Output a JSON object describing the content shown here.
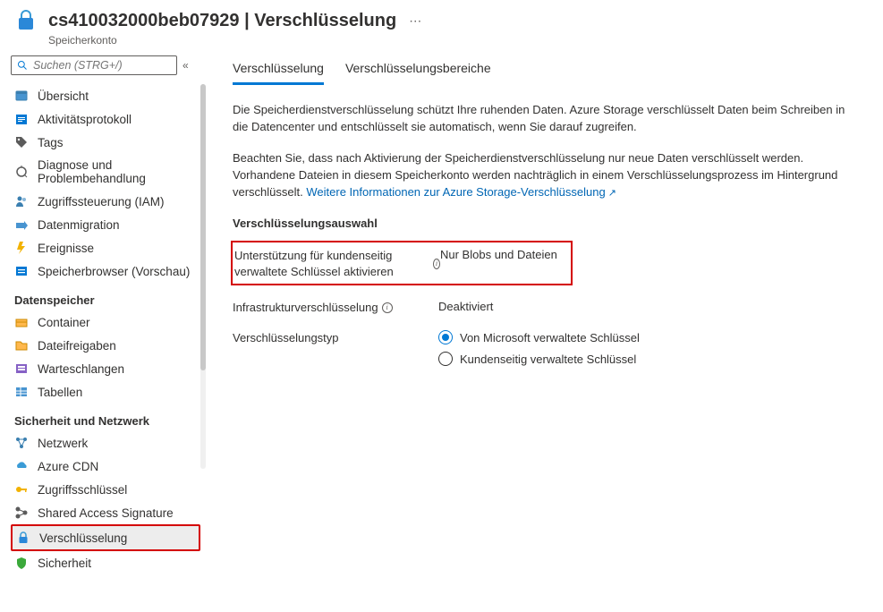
{
  "header": {
    "title": "cs410032000beb07929 | Verschlüsselung",
    "subtitle": "Speicherkonto"
  },
  "search": {
    "placeholder": "Suchen (STRG+/)"
  },
  "nav": {
    "general": [
      {
        "label": "Übersicht",
        "icon": "overview"
      },
      {
        "label": "Aktivitätsprotokoll",
        "icon": "activity"
      },
      {
        "label": "Tags",
        "icon": "tags"
      },
      {
        "label": "Diagnose und Problembehandlung",
        "icon": "diagnose"
      },
      {
        "label": "Zugriffssteuerung (IAM)",
        "icon": "iam"
      },
      {
        "label": "Datenmigration",
        "icon": "migration"
      },
      {
        "label": "Ereignisse",
        "icon": "events"
      },
      {
        "label": "Speicherbrowser (Vorschau)",
        "icon": "browser"
      }
    ],
    "datastore_title": "Datenspeicher",
    "datastore": [
      {
        "label": "Container",
        "icon": "container"
      },
      {
        "label": "Dateifreigaben",
        "icon": "fileshare"
      },
      {
        "label": "Warteschlangen",
        "icon": "queue"
      },
      {
        "label": "Tabellen",
        "icon": "table"
      }
    ],
    "security_title": "Sicherheit und Netzwerk",
    "security": [
      {
        "label": "Netzwerk",
        "icon": "network"
      },
      {
        "label": "Azure CDN",
        "icon": "cdn"
      },
      {
        "label": "Zugriffsschlüssel",
        "icon": "key"
      },
      {
        "label": "Shared Access Signature",
        "icon": "sas"
      },
      {
        "label": "Verschlüsselung",
        "icon": "lock",
        "selected": true,
        "highlight": true
      },
      {
        "label": "Sicherheit",
        "icon": "shield"
      }
    ]
  },
  "tabs": [
    {
      "label": "Verschlüsselung",
      "active": true
    },
    {
      "label": "Verschlüsselungsbereiche"
    }
  ],
  "paragraph1": "Die Speicherdienstverschlüsselung schützt Ihre ruhenden Daten. Azure Storage verschlüsselt Daten beim Schreiben in die Datencenter und entschlüsselt sie automatisch, wenn Sie darauf zugreifen.",
  "paragraph2_pre": "Beachten Sie, dass nach Aktivierung der Speicherdienstverschlüsselung nur neue Daten verschlüsselt werden. Vorhandene Dateien in diesem Speicherkonto werden nachträglich in einem Verschlüsselungsprozess im Hintergrund verschlüsselt. ",
  "paragraph2_link": "Weitere Informationen zur Azure Storage-Verschlüsselung",
  "section_heading": "Verschlüsselungsauswahl",
  "fields": {
    "cmk_support_label": "Unterstützung für kundenseitig verwaltete Schlüssel aktivieren",
    "cmk_support_value": "Nur Blobs und Dateien",
    "infra_label": "Infrastrukturverschlüsselung",
    "infra_value": "Deaktiviert",
    "enc_type_label": "Verschlüsselungstyp",
    "enc_options": [
      {
        "label": "Von Microsoft verwaltete Schlüssel",
        "checked": true
      },
      {
        "label": "Kundenseitig verwaltete Schlüssel",
        "checked": false
      }
    ]
  }
}
